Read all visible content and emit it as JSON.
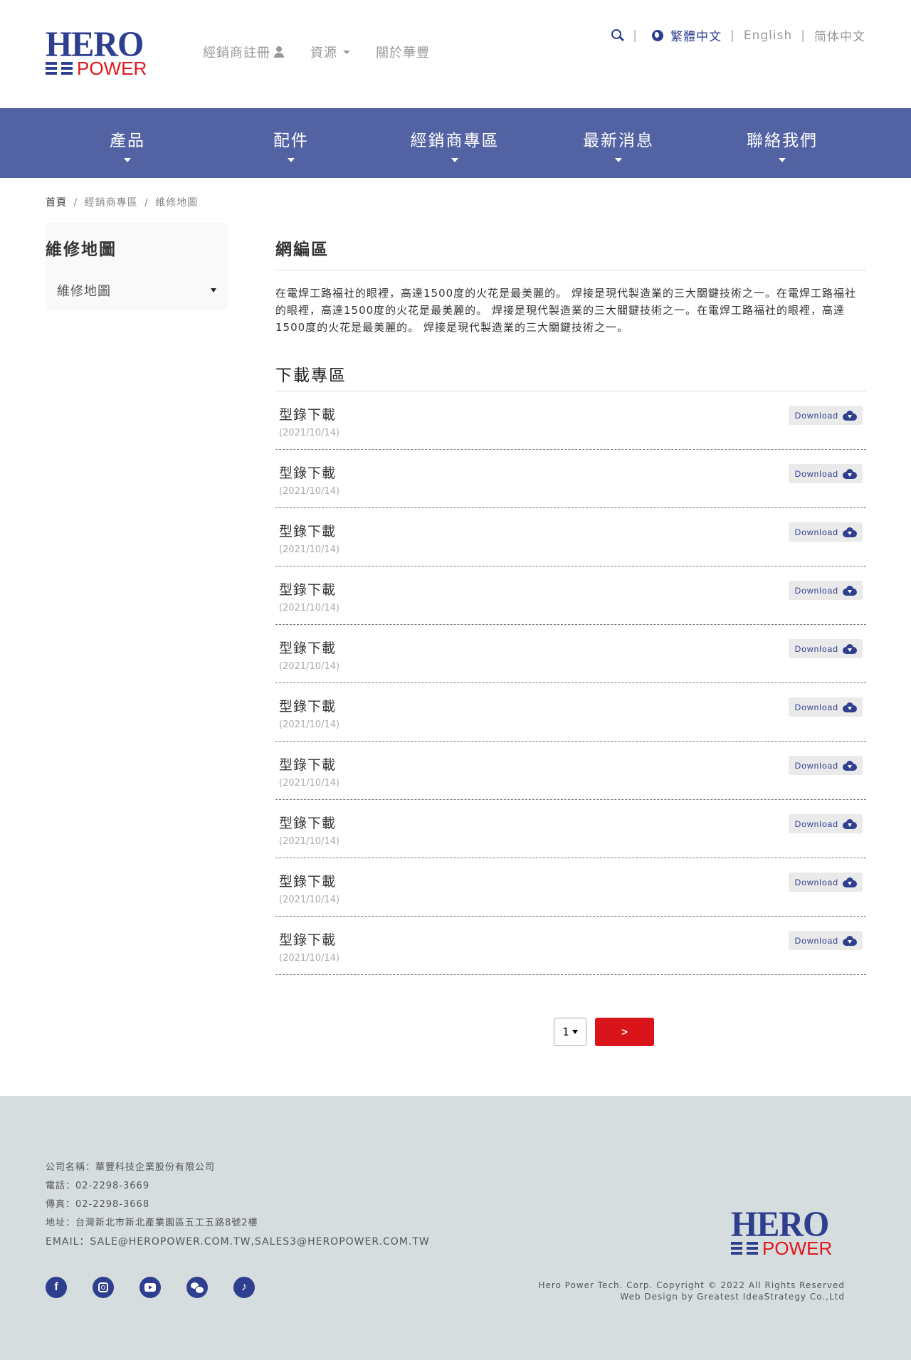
{
  "brand": {
    "logo_top": "HERO",
    "logo_bottom": "POWER",
    "primary_color": "#2f3f8f",
    "accent_color": "#e3161c",
    "nav_color": "#5262a3"
  },
  "topnav": {
    "items": [
      {
        "label": "經銷商註冊",
        "icon": "user-icon"
      },
      {
        "label": "資源",
        "icon": "caret-down-icon"
      },
      {
        "label": "關於華豐"
      }
    ]
  },
  "langbar": {
    "search_icon": "search-icon",
    "globe_icon": "globe-icon",
    "languages": [
      "繁體中文",
      "English",
      "简体中文"
    ],
    "active": "繁體中文",
    "separator": "|"
  },
  "mainnav": {
    "items": [
      {
        "label": "產品"
      },
      {
        "label": "配件"
      },
      {
        "label": "經銷商專區"
      },
      {
        "label": "最新消息"
      },
      {
        "label": "聯絡我們"
      }
    ]
  },
  "breadcrumb": {
    "items": [
      "首頁",
      "經銷商專區",
      "維修地圖"
    ],
    "separator": "/"
  },
  "sidebar": {
    "title": "維修地圖",
    "items": [
      {
        "label": "維修地圖"
      }
    ]
  },
  "main": {
    "title": "網編區",
    "intro": "在電焊工路福社的眼裡，高達1500度的火花是最美麗的。 焊接是現代製造業的三大關鍵技術之一。在電焊工路福社的眼裡，高達1500度的火花是最美麗的。 焊接是現代製造業的三大關鍵技術之一。在電焊工路福社的眼裡，高達1500度的火花是最美麗的。 焊接是現代製造業的三大關鍵技術之一。",
    "download_title": "下載專區",
    "download_button_label": "Download",
    "downloads": [
      {
        "name": "型錄下載",
        "date": "(2021/10/14)"
      },
      {
        "name": "型錄下載",
        "date": "(2021/10/14)"
      },
      {
        "name": "型錄下載",
        "date": "(2021/10/14)"
      },
      {
        "name": "型錄下載",
        "date": "(2021/10/14)"
      },
      {
        "name": "型錄下載",
        "date": "(2021/10/14)"
      },
      {
        "name": "型錄下載",
        "date": "(2021/10/14)"
      },
      {
        "name": "型錄下載",
        "date": "(2021/10/14)"
      },
      {
        "name": "型錄下載",
        "date": "(2021/10/14)"
      },
      {
        "name": "型錄下載",
        "date": "(2021/10/14)"
      },
      {
        "name": "型錄下載",
        "date": "(2021/10/14)"
      }
    ]
  },
  "pagination": {
    "current_page": "1",
    "next_label": ">"
  },
  "footer": {
    "company": "公司名稱：華豐科技企業股份有限公司",
    "phone": "電話：02-2298-3669",
    "fax": "傳真：02-2298-3668",
    "address": "地址：台灣新北市新北產業園區五工五路8號2樓",
    "email": "EMAIL：SALE@HEROPOWER.COM.TW,SALES3@HEROPOWER.COM.TW",
    "social": [
      "facebook-icon",
      "instagram-icon",
      "youtube-icon",
      "wechat-icon",
      "tiktok-icon"
    ],
    "copyright": "Hero Power Tech. Corp. Copyright © 2022 All Rights Reserved",
    "credit": "Web Design by Greatest IdeaStrategy Co.,Ltd"
  }
}
